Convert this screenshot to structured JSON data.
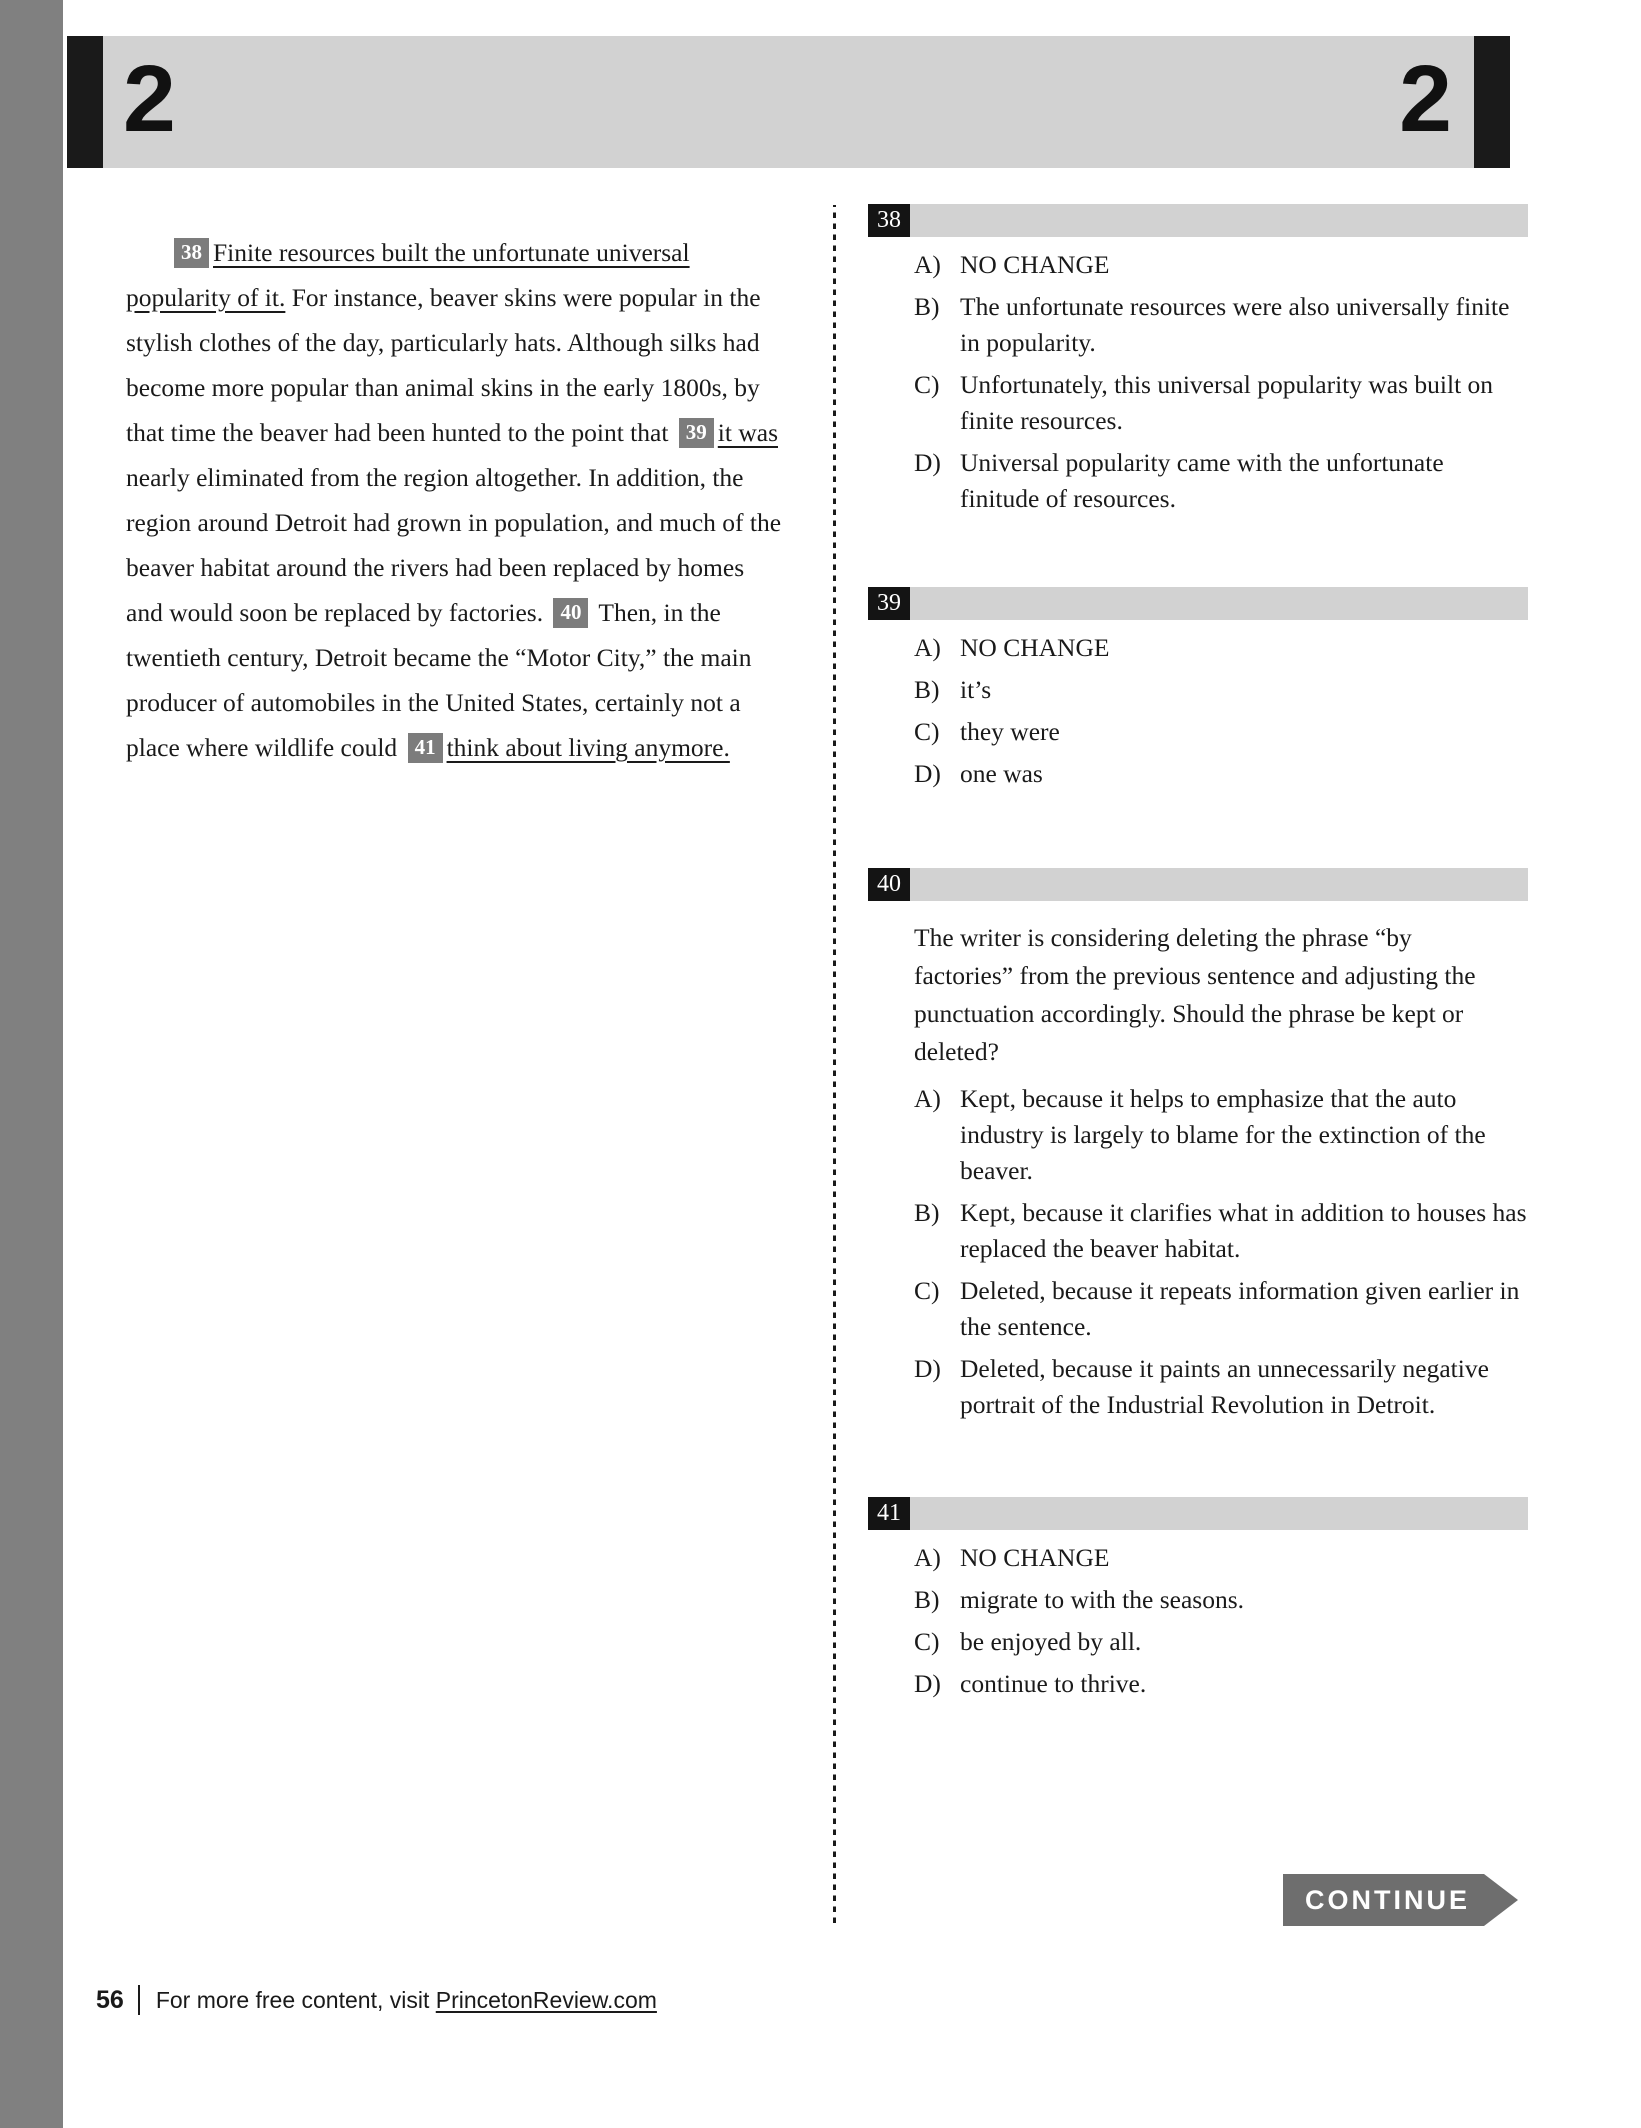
{
  "header": {
    "section_number_left": "2",
    "section_number_right": "2"
  },
  "passage": {
    "segments": [
      {
        "type": "indent"
      },
      {
        "type": "badge",
        "text": "38"
      },
      {
        "type": "underline",
        "text": "Finite resources built the unfortunate universal popularity of it."
      },
      {
        "type": "text",
        "text": " For instance, beaver skins were popular in the stylish clothes of the day, particularly hats. Although silks had become more popular than animal skins in the early 1800s, by that time the beaver had been hunted to the point that "
      },
      {
        "type": "badge",
        "text": "39"
      },
      {
        "type": "underline",
        "text": "it was"
      },
      {
        "type": "text",
        "text": " nearly eliminated from the region altogether. In addition, the region around Detroit had grown in population, and much of the beaver habitat around the rivers had been replaced by homes and would soon be replaced by factories. "
      },
      {
        "type": "badge",
        "text": "40"
      },
      {
        "type": "text",
        "text": " Then, in the twentieth century, Detroit became the “Motor City,” the main producer of automobiles in the United States, certainly not a place where wildlife could "
      },
      {
        "type": "badge",
        "text": "41"
      },
      {
        "type": "underline",
        "text": "think about living anymore."
      }
    ]
  },
  "questions": [
    {
      "number": "38",
      "stem": "",
      "choices": [
        {
          "letter": "A)",
          "text": "NO CHANGE"
        },
        {
          "letter": "B)",
          "text": "The unfortunate resources were also universally finite in popularity."
        },
        {
          "letter": "C)",
          "text": "Unfortunately, this universal popularity was built on finite resources."
        },
        {
          "letter": "D)",
          "text": "Universal popularity came with the unfortunate finitude of resources."
        }
      ]
    },
    {
      "number": "39",
      "stem": "",
      "choices": [
        {
          "letter": "A)",
          "text": "NO CHANGE"
        },
        {
          "letter": "B)",
          "text": "it’s"
        },
        {
          "letter": "C)",
          "text": "they were"
        },
        {
          "letter": "D)",
          "text": "one was"
        }
      ]
    },
    {
      "number": "40",
      "stem": "The writer is considering deleting the phrase “by factories” from the previous sentence and adjusting the punctuation accordingly. Should the phrase be kept or deleted?",
      "choices": [
        {
          "letter": "A)",
          "text": "Kept, because it helps to emphasize that the auto industry is largely to blame for the extinction of the beaver."
        },
        {
          "letter": "B)",
          "text": "Kept, because it clarifies what in addition to houses has replaced the beaver habitat."
        },
        {
          "letter": "C)",
          "text": "Deleted, because it repeats information given earlier in the sentence."
        },
        {
          "letter": "D)",
          "text": "Deleted, because it paints an unnecessarily negative portrait of the Industrial Revolution in Detroit."
        }
      ]
    },
    {
      "number": "41",
      "stem": "",
      "choices": [
        {
          "letter": "A)",
          "text": "NO CHANGE"
        },
        {
          "letter": "B)",
          "text": "migrate to with the seasons."
        },
        {
          "letter": "C)",
          "text": "be enjoyed by all."
        },
        {
          "letter": "D)",
          "text": "continue to thrive."
        }
      ]
    }
  ],
  "continue_button": {
    "label": "CONTINUE"
  },
  "footer": {
    "page_number": "56",
    "text_before_link": "For more free content, visit ",
    "link_text": "PrincetonReview.com"
  },
  "colors": {
    "page_edge": "#808080",
    "header_bar": "#d2d2d2",
    "header_block": "#1a1a1a",
    "question_badge": "#141414",
    "question_bar": "#d2d2d2",
    "inline_badge": "#7c7c7c",
    "continue": "#6e6e6e"
  }
}
